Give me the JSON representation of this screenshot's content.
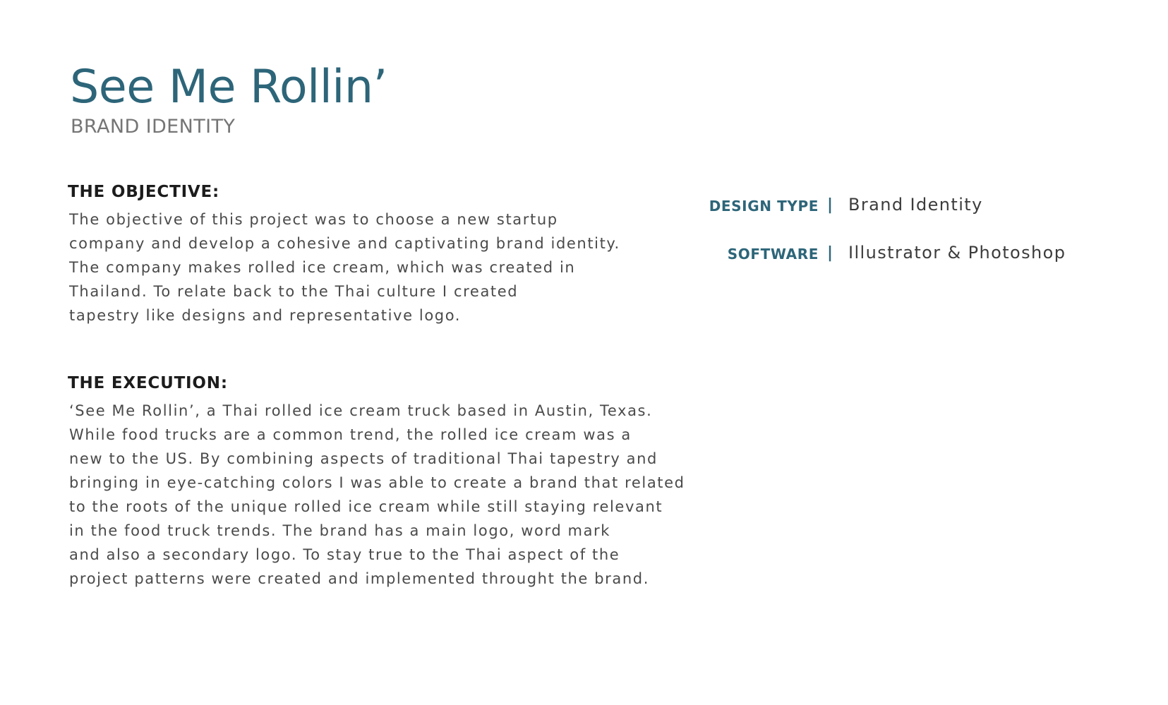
{
  "header": {
    "title": "See Me Rollin’",
    "subtitle": "BRAND IDENTITY"
  },
  "objective": {
    "heading": "THE OBJECTIVE:",
    "lines": [
      "The objective of this project was to choose a new startup",
      "company and develop a cohesive and captivating brand identity.",
      "The company makes rolled ice cream, which was created in",
      "Thailand. To relate back to the Thai culture I created",
      "tapestry like designs and representative logo."
    ]
  },
  "execution": {
    "heading": "THE EXECUTION:",
    "lines": [
      "‘See Me Rollin’, a Thai rolled ice cream truck based in Austin, Texas.",
      "While food trucks are a common trend, the rolled ice cream was a",
      "new to the US. By combining aspects of traditional Thai tapestry and",
      "bringing in eye-catching colors I was able to create a brand that related",
      "to the roots of the unique rolled ice cream while still staying relevant",
      "in the food truck trends. The brand has a main logo, word mark",
      "and also a secondary logo. To stay true to the Thai aspect of the",
      "project patterns were created and implemented throught the brand."
    ]
  },
  "meta": {
    "separator": "|",
    "rows": [
      {
        "label": "DESIGN TYPE",
        "value": "Brand Identity"
      },
      {
        "label": "SOFTWARE",
        "value": "Illustrator & Photoshop"
      }
    ]
  },
  "colors": {
    "accent": "#2d6579",
    "heading": "#1c1c1c",
    "body": "#4a4a4a",
    "subtitle": "#757575"
  }
}
